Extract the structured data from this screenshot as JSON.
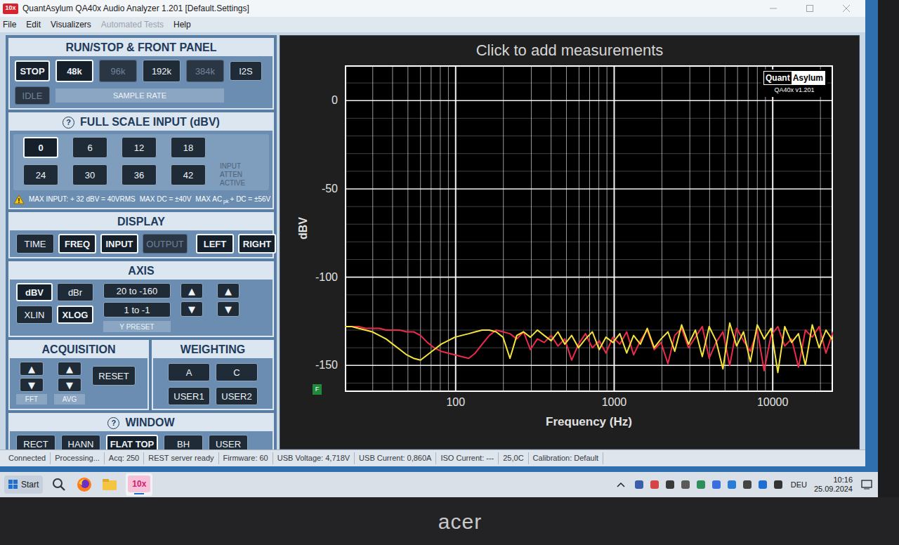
{
  "window": {
    "icon_text": "10x",
    "title": "QuantAsylum QA40x Audio Analyzer 1.201 [Default.Settings]"
  },
  "menu": [
    {
      "label": "File",
      "disabled": false
    },
    {
      "label": "Edit",
      "disabled": false
    },
    {
      "label": "Visualizers",
      "disabled": false
    },
    {
      "label": "Automated Tests",
      "disabled": true
    },
    {
      "label": "Help",
      "disabled": false
    }
  ],
  "run_panel": {
    "title": "RUN/STOP & FRONT PANEL",
    "run": {
      "label": "STOP",
      "selected": true,
      "disabled": false
    },
    "idle": {
      "label": "IDLE",
      "selected": false,
      "disabled": true
    },
    "sample_rates": [
      {
        "label": "48k",
        "selected": true,
        "disabled": false
      },
      {
        "label": "96k",
        "selected": false,
        "disabled": true
      },
      {
        "label": "192k",
        "selected": false,
        "disabled": false
      },
      {
        "label": "384k",
        "selected": false,
        "disabled": true
      }
    ],
    "sample_rate_label": "SAMPLE RATE",
    "i2s": {
      "label": "I2S",
      "selected": false,
      "disabled": false
    }
  },
  "full_scale": {
    "help": "?",
    "title": "FULL SCALE INPUT (dBV)",
    "options": [
      {
        "label": "0",
        "selected": true,
        "disabled": false
      },
      {
        "label": "6",
        "selected": false,
        "disabled": false
      },
      {
        "label": "12",
        "selected": false,
        "disabled": false
      },
      {
        "label": "18",
        "selected": false,
        "disabled": false
      },
      {
        "label": "24",
        "selected": false,
        "disabled": false
      },
      {
        "label": "30",
        "selected": false,
        "disabled": false
      },
      {
        "label": "36",
        "selected": false,
        "disabled": false
      },
      {
        "label": "42",
        "selected": false,
        "disabled": false
      }
    ],
    "atten": {
      "label": "INPUT ATTEN ACTIVE",
      "on": false
    },
    "warning": {
      "max_input": "MAX INPUT: + 32 dBV = 40VRMS",
      "max_dc": "MAX DC = ±40V",
      "max_ac": "MAX AC",
      "max_ac_sub": "pk",
      "max_ac_rest": "+ DC = ±56V"
    }
  },
  "display": {
    "title": "DISPLAY",
    "buttons": [
      {
        "label": "TIME",
        "selected": false,
        "disabled": false
      },
      {
        "label": "FREQ",
        "selected": true,
        "disabled": false
      },
      {
        "label": "INPUT",
        "selected": true,
        "disabled": false
      },
      {
        "label": "OUTPUT",
        "selected": false,
        "disabled": true
      },
      {
        "label": "LEFT",
        "selected": true,
        "disabled": false
      },
      {
        "label": "RIGHT",
        "selected": true,
        "disabled": false
      }
    ]
  },
  "axis": {
    "title": "AXIS",
    "units": [
      {
        "label": "dBV",
        "selected": true,
        "disabled": false
      },
      {
        "label": "dBr",
        "selected": false,
        "disabled": false
      }
    ],
    "x_scale": [
      {
        "label": "XLIN",
        "selected": false,
        "disabled": false
      },
      {
        "label": "XLOG",
        "selected": true,
        "disabled": false
      }
    ],
    "presets": [
      {
        "label": "20 to -160",
        "selected": false,
        "disabled": false
      },
      {
        "label": "1 to -1",
        "selected": false,
        "disabled": false
      }
    ],
    "preset_label": "Y PRESET",
    "y_min": [
      {
        "label": "▲",
        "selected": false,
        "disabled": false
      },
      {
        "label": "▼",
        "selected": false,
        "disabled": false
      }
    ],
    "y_max": [
      {
        "label": "▲",
        "selected": false,
        "disabled": false
      },
      {
        "label": "▼",
        "selected": false,
        "disabled": false
      }
    ]
  },
  "acquisition": {
    "title": "ACQUISITION",
    "fft": [
      {
        "label": "▲",
        "selected": false,
        "disabled": false
      },
      {
        "label": "▼",
        "selected": false,
        "disabled": false
      }
    ],
    "avg": [
      {
        "label": "▲",
        "selected": false,
        "disabled": false
      },
      {
        "label": "▼",
        "selected": false,
        "disabled": false
      }
    ],
    "reset": {
      "label": "RESET",
      "selected": false,
      "disabled": false
    },
    "fft_label": "FFT",
    "avg_label": "AVG"
  },
  "weighting": {
    "title": "WEIGHTING",
    "buttons": [
      {
        "label": "A",
        "selected": false,
        "disabled": false
      },
      {
        "label": "C",
        "selected": false,
        "disabled": false
      },
      {
        "label": "USER1",
        "selected": false,
        "disabled": false
      },
      {
        "label": "USER2",
        "selected": false,
        "disabled": false
      }
    ]
  },
  "window_fn": {
    "help": "?",
    "title": "WINDOW",
    "buttons": [
      {
        "label": "RECT",
        "selected": false,
        "disabled": false
      },
      {
        "label": "HANN",
        "selected": false,
        "disabled": false
      },
      {
        "label": "FLAT TOP",
        "selected": true,
        "disabled": false
      },
      {
        "label": "BH",
        "selected": false,
        "disabled": false
      },
      {
        "label": "USER",
        "selected": false,
        "disabled": false
      }
    ]
  },
  "chart": {
    "title": "Click to add measurements",
    "y_label": "dBV",
    "x_label": "Frequency (Hz)",
    "y_ticks": [
      {
        "label": "0",
        "value": 0
      },
      {
        "label": "-50",
        "value": -50
      },
      {
        "label": "-100",
        "value": -100
      },
      {
        "label": "-150",
        "value": -150
      }
    ],
    "x_ticks": [
      {
        "label": "100",
        "value": 100
      },
      {
        "label": "1000",
        "value": 1000
      },
      {
        "label": "10000",
        "value": 10000
      }
    ],
    "logo": {
      "left": "Quant",
      "right": "Asylum",
      "version": "QA40x v1.201"
    },
    "marker": "F",
    "frequencies_hz": [
      20,
      22.1,
      24.4,
      27,
      29.8,
      33,
      36.4,
      40.2,
      44.5,
      49.1,
      54.3,
      60,
      66.3,
      73.2,
      80.9,
      89.4,
      98.8,
      109,
      121,
      133,
      147,
      163,
      180,
      199,
      220,
      243,
      268,
      296,
      328,
      362,
      400,
      442,
      488,
      539,
      596,
      659,
      728,
      804,
      888,
      982,
      1085,
      1199,
      1325,
      1464,
      1617,
      1787,
      1975,
      2182,
      2411,
      2664,
      2944,
      3253,
      3594,
      3972,
      4389,
      4850,
      5359,
      5921,
      6543,
      7230,
      7989,
      8828,
      9755,
      10779,
      11911,
      13161,
      14543,
      16070,
      17757,
      19622,
      21682,
      24000
    ],
    "series": [
      {
        "color": "#ee2a4a",
        "values": [
          -128,
          -128,
          -128,
          -129,
          -129,
          -129,
          -130,
          -130,
          -130,
          -131,
          -131,
          -133,
          -137,
          -140,
          -142,
          -143,
          -144,
          -145,
          -146,
          -143,
          -138,
          -133,
          -130,
          -131,
          -132,
          -135,
          -131,
          -141,
          -135,
          -137,
          -133,
          -139,
          -135,
          -147,
          -138,
          -132,
          -140,
          -136,
          -143,
          -134,
          -138,
          -131,
          -144,
          -136,
          -130,
          -141,
          -137,
          -149,
          -133,
          -129,
          -140,
          -134,
          -128,
          -146,
          -137,
          -131,
          -150,
          -129,
          -136,
          -142,
          -130,
          -153,
          -133,
          -128,
          -139,
          -135,
          -151,
          -130,
          -134,
          -128,
          -143,
          -131
        ]
      },
      {
        "color": "#f4e43a",
        "values": [
          -128,
          -128,
          -129,
          -130,
          -131,
          -133,
          -135,
          -138,
          -141,
          -144,
          -146,
          -147,
          -144,
          -141,
          -138,
          -136,
          -134,
          -133,
          -132,
          -131,
          -130,
          -130,
          -131,
          -134,
          -146,
          -133,
          -131,
          -134,
          -130,
          -133,
          -136,
          -131,
          -138,
          -133,
          -140,
          -135,
          -131,
          -141,
          -134,
          -137,
          -132,
          -143,
          -133,
          -138,
          -129,
          -140,
          -135,
          -131,
          -142,
          -127,
          -138,
          -130,
          -145,
          -128,
          -136,
          -152,
          -126,
          -139,
          -131,
          -148,
          -127,
          -135,
          -129,
          -154,
          -128,
          -137,
          -132,
          -150,
          -127,
          -140,
          -130,
          -136
        ]
      }
    ]
  },
  "status_bar": [
    "Connected",
    "Processing...",
    "Acq: 250",
    "REST server ready",
    "Firmware: 60",
    "USB Voltage: 4,718V",
    "USB Current: 0,860A",
    "ISO Current: ---",
    "25,0C",
    "Calibration: Default"
  ],
  "taskbar": {
    "start": "Start",
    "apps": [
      {
        "label": "10x",
        "selected": true
      }
    ],
    "language": "DEU",
    "time": "10:16",
    "date": "25.09.2024"
  },
  "bezel": {
    "logo": "acer"
  }
}
